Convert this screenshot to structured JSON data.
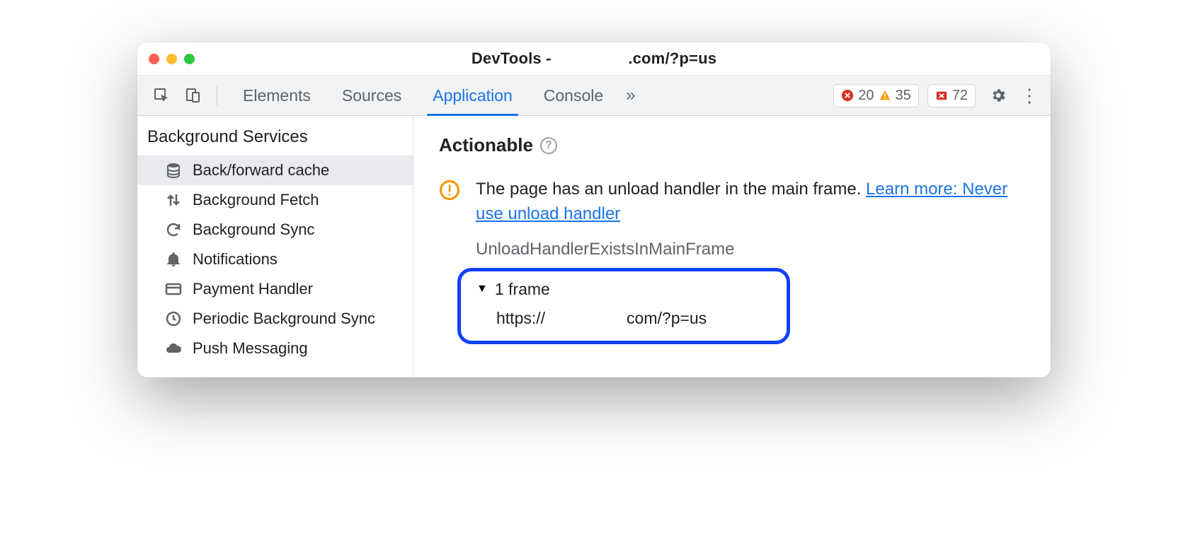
{
  "window": {
    "title_prefix": "DevTools -",
    "title_url": ".com/?p=us"
  },
  "toolbar": {
    "tabs": [
      {
        "label": "Elements",
        "active": false
      },
      {
        "label": "Sources",
        "active": false
      },
      {
        "label": "Application",
        "active": true
      },
      {
        "label": "Console",
        "active": false
      }
    ],
    "more_glyph": "»",
    "errors_count": "20",
    "warnings_count": "35",
    "issues_count": "72"
  },
  "sidebar": {
    "title": "Background Services",
    "items": [
      {
        "label": "Back/forward cache",
        "selected": true,
        "icon": "database"
      },
      {
        "label": "Background Fetch",
        "selected": false,
        "icon": "updown"
      },
      {
        "label": "Background Sync",
        "selected": false,
        "icon": "sync"
      },
      {
        "label": "Notifications",
        "selected": false,
        "icon": "bell"
      },
      {
        "label": "Payment Handler",
        "selected": false,
        "icon": "card"
      },
      {
        "label": "Periodic Background Sync",
        "selected": false,
        "icon": "clock"
      },
      {
        "label": "Push Messaging",
        "selected": false,
        "icon": "cloud"
      }
    ]
  },
  "main": {
    "section_title": "Actionable",
    "issue_text": "The page has an unload handler in the main frame. ",
    "issue_link": "Learn more: Never use unload handler",
    "reason_name": "UnloadHandlerExistsInMainFrame",
    "frame_count_label": "1 frame",
    "frame_url": "https://                  com/?p=us"
  }
}
